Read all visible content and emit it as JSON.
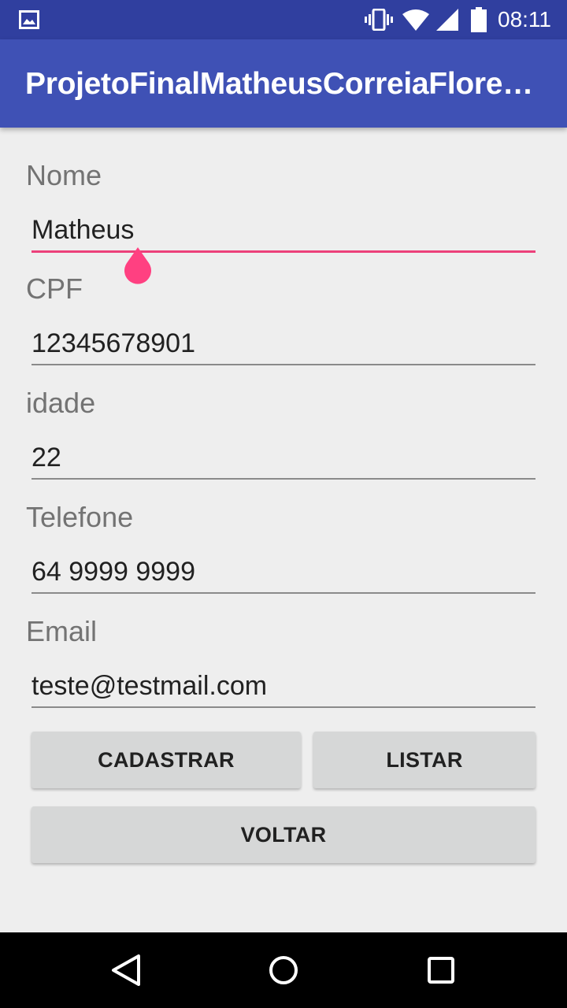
{
  "status_bar": {
    "time": "08:11",
    "icons": [
      "gallery-icon",
      "vibrate-icon",
      "wifi-icon",
      "signal-icon",
      "battery-icon"
    ]
  },
  "app_bar": {
    "title": "ProjetoFinalMatheusCorreiaFlorentino"
  },
  "form": {
    "nome": {
      "label": "Nome",
      "value": "Matheus"
    },
    "cpf": {
      "label": "CPF",
      "value": "12345678901"
    },
    "idade": {
      "label": "idade",
      "value": "22"
    },
    "telefone": {
      "label": "Telefone",
      "value": "64 9999 9999"
    },
    "email": {
      "label": "Email",
      "value": "teste@testmail.com"
    }
  },
  "buttons": {
    "cadastrar": "CADASTRAR",
    "listar": "LISTAR",
    "voltar": "VOLTAR"
  },
  "nav_bar": {
    "icons": [
      "back-icon",
      "home-icon",
      "recent-apps-icon"
    ]
  },
  "colors": {
    "primary": "#3f51b5",
    "primary_dark": "#303f9f",
    "accent": "#ec407a",
    "background": "#eeeeee",
    "button": "#d6d7d7"
  }
}
